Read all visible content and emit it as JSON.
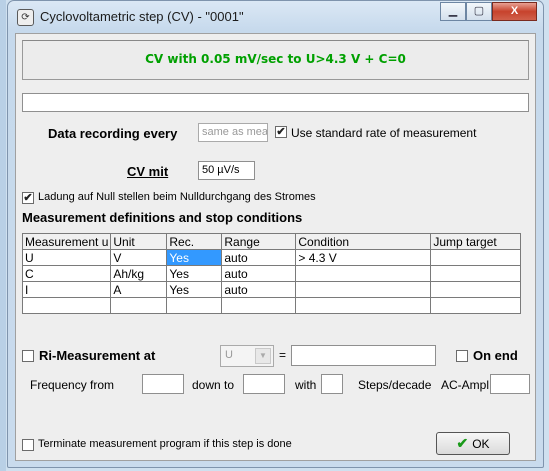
{
  "window": {
    "title": "Cyclovoltametric step (CV) - \"0001\"",
    "minimize_glyph": "▁",
    "maximize_glyph": "▢",
    "close_glyph": "X"
  },
  "banner": {
    "text": "CV with 0.05 mV/sec to U>4.3 V + C=0"
  },
  "description": {
    "value": ""
  },
  "data_recording": {
    "label": "Data recording every",
    "value": "same as meas",
    "use_standard_checked": "✔",
    "use_standard_label": "Use standard rate of measurement"
  },
  "cv": {
    "label": "CV mit",
    "value": "50 µV/s"
  },
  "ladung": {
    "checked": "✔",
    "label": "Ladung auf Null stellen beim Nulldurchgang des Stromes"
  },
  "section_title": "Measurement definitions and stop conditions",
  "table": {
    "headers": [
      "Measurement u",
      "Unit",
      "Rec.",
      "Range",
      "Condition",
      "Jump target"
    ],
    "rows": [
      [
        "U",
        "V",
        "Yes",
        "auto",
        "> 4.3 V",
        ""
      ],
      [
        "C",
        "Ah/kg",
        "Yes",
        "auto",
        "",
        ""
      ],
      [
        "I",
        "A",
        "Yes",
        "auto",
        "",
        ""
      ],
      [
        "",
        "",
        "",
        "",
        "",
        ""
      ]
    ]
  },
  "ri": {
    "label": "Ri-Measurement at",
    "select_value": "U",
    "equals": "=",
    "value": "",
    "on_end_label": "On end"
  },
  "frequency": {
    "from_label": "Frequency from",
    "from_value": "",
    "down_to_label": "down to",
    "down_to_value": "",
    "with_label": "with",
    "with_value": "",
    "steps_label": "Steps/decade",
    "ac_label": "AC-Ampl.",
    "ac_value": ""
  },
  "terminate": {
    "label": "Terminate measurement program if this step is done"
  },
  "ok_button": {
    "label": "OK"
  },
  "icons": {
    "app": "cycle-icon",
    "check": "checkmark-icon",
    "dropdown": "chevron-down-icon"
  }
}
